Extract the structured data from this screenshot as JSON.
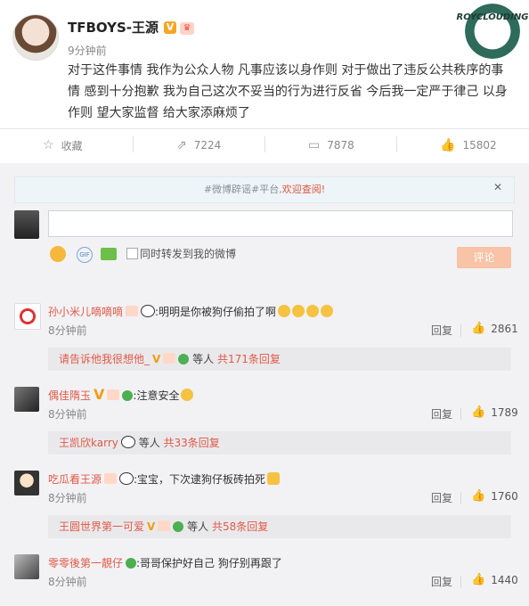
{
  "post": {
    "author": "TFBOYS-王源",
    "time": "9分钟前",
    "text": "对于这件事情 我作为公众人物 凡事应该以身作则 对于做出了违反公共秩序的事情 感到十分抱歉 我为自己这次不妥当的行为进行反省 今后我一定严于律己 以身作则 望大家监督 给大家添麻烦了",
    "watermark": "ROYCLOUDING"
  },
  "actions": {
    "favorite": "收藏",
    "repost": "7224",
    "comment": "7878",
    "like": "15802"
  },
  "notice": {
    "prefix": "#微博辟谣#平台,",
    "highlight": "欢迎查阅!"
  },
  "composer": {
    "repost_label": "同时转发到我的微博",
    "submit": "评论",
    "gif": "GIF"
  },
  "comments": [
    {
      "name": "孙小米儿嘀嘀嘀",
      "text": ":明明是你被狗仔偷拍了啊",
      "time": "8分钟前",
      "reply": "回复",
      "likes": "2861",
      "sub_name": "请告诉他我很想他_",
      "sub_suffix": "等人",
      "sub_count": "共171条回复"
    },
    {
      "name": "偶佳隋玉",
      "text": ":注意安全",
      "time": "8分钟前",
      "reply": "回复",
      "likes": "1789",
      "sub_name": "王凯欣karry",
      "sub_suffix": "等人",
      "sub_count": "共33条回复"
    },
    {
      "name": "吃瓜看王源",
      "text": ":宝宝，下次逮狗仔板砖拍死",
      "time": "8分钟前",
      "reply": "回复",
      "likes": "1760",
      "sub_name": "王圆世界第一可爱",
      "sub_suffix": "等人",
      "sub_count": "共58条回复"
    },
    {
      "name": "零零後第一靚仔",
      "text": ":哥哥保护好自己 狗仔别再跟了",
      "time": "8分钟前",
      "reply": "回复",
      "likes": "1440"
    }
  ]
}
